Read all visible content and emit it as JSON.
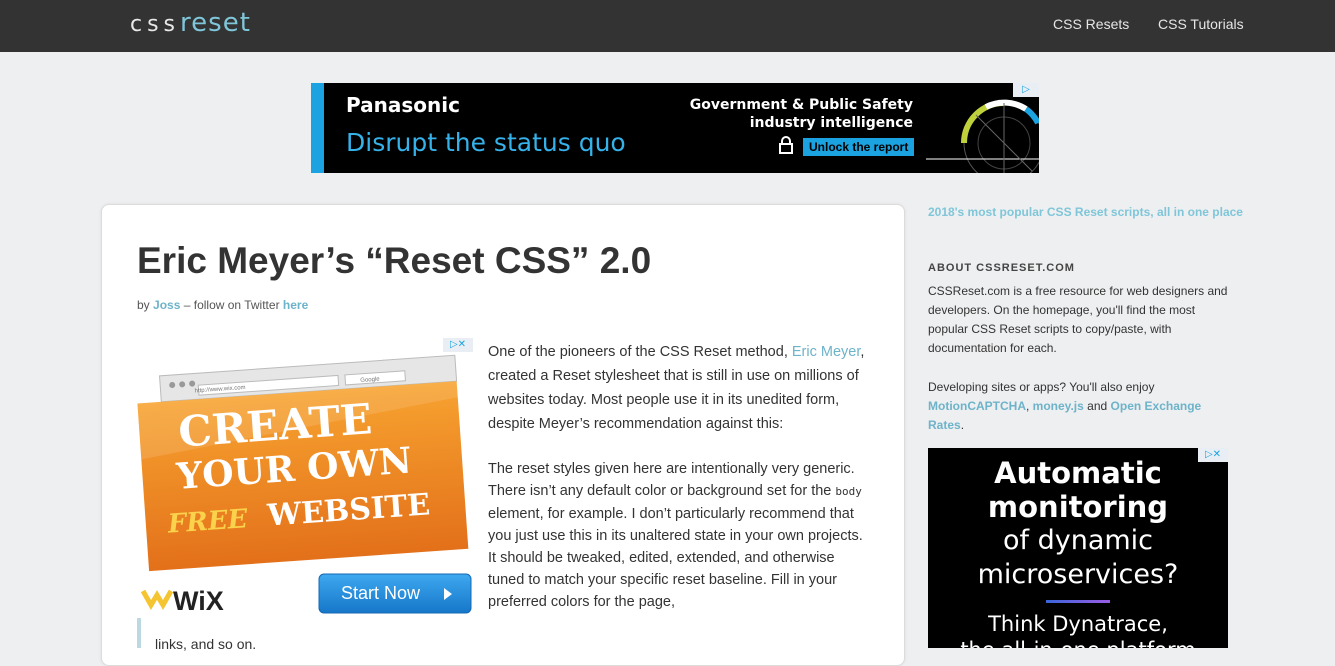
{
  "header": {
    "logo_part1": "css",
    "logo_part2": "reset",
    "nav": [
      "CSS Resets",
      "CSS Tutorials"
    ]
  },
  "top_ad": {
    "brand": "Panasonic",
    "tagline": "Disrupt the status quo",
    "line1": "Government & Public Safety",
    "line2": "industry intelligence",
    "cta": "Unlock the report",
    "accent": "#1aa3e0"
  },
  "article": {
    "title": "Eric Meyer’s “Reset CSS” 2.0",
    "by": "by",
    "author": "Joss",
    "follow": "–  follow on Twitter",
    "follow_link": "here",
    "p1_a": "One of the pioneers of the CSS Reset method,",
    "p1_link": "Eric Meyer",
    "p1_b": ", created a Reset stylesheet that is still in use on millions of websites today. Most people use it in its unedited form, despite Meyer’s recommendation against this:",
    "p2_a": "The reset styles given here are intentionally very generic. There isn’t any default color or background set for the",
    "p2_code": "body",
    "p2_b": "element, for example. I don’t particularly recommend that you just use this in its unaltered state in your own projects. It should be tweaked, edited, extended, and otherwise tuned to match your specific reset baseline. Fill in your preferred colors for the page,",
    "tail": "links, and so on."
  },
  "wix_ad": {
    "url": "http://www.wix.com",
    "search": "Google",
    "line1": "CREATE",
    "line2": "YOUR OWN",
    "line3a": "FREE",
    "line3b": "WEBSITE",
    "brand": "WiX",
    "cta": "Start Now"
  },
  "sidebar": {
    "headline": "2018's most popular CSS Reset scripts, all in one place",
    "about_title": "ABOUT CSSRESET.COM",
    "about_p1": "CSSReset.com is a free resource for web designers and developers. On the homepage, you'll find the most popular CSS Reset scripts to copy/paste, with documentation for each.",
    "about_p2_a": "Developing sites or apps? You'll also enjoy",
    "link1": "MotionCAPTCHA",
    "sep": ",",
    "link2": "money.js",
    "and": "and",
    "link3": "Open Exchange Rates",
    "period": "."
  },
  "side_ad": {
    "line1": "Automatic",
    "line2": "monitoring",
    "line3": "of dynamic",
    "line4": "microservices?",
    "line5": "Think Dynatrace,",
    "line6": "the all-in-one platform"
  }
}
